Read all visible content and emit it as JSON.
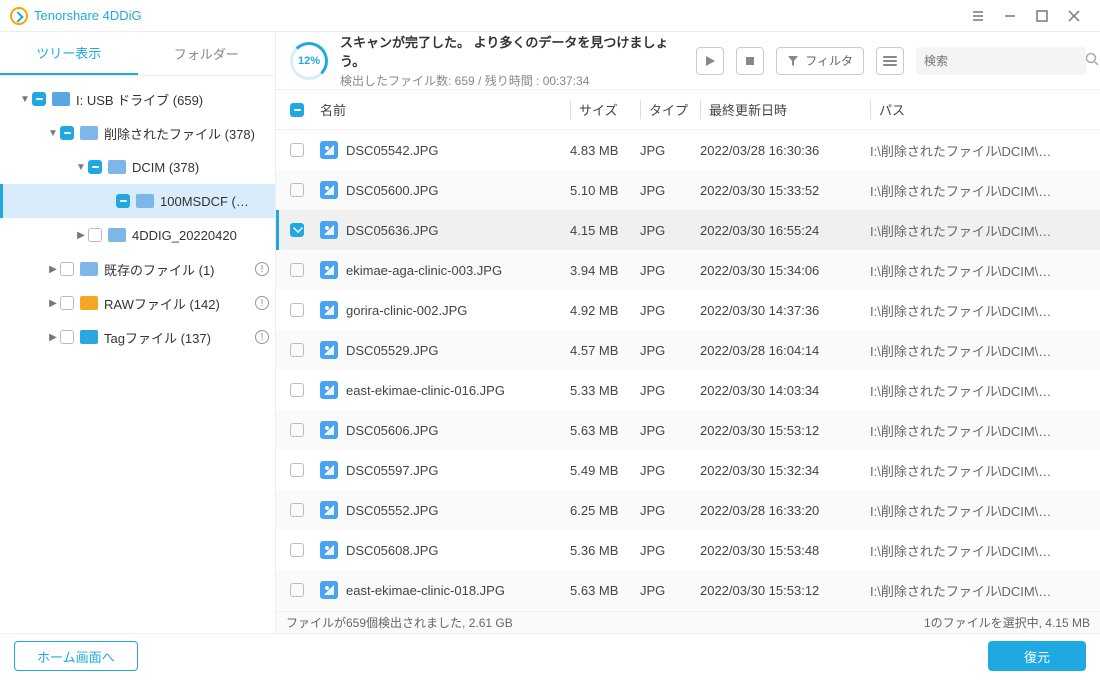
{
  "app_title": "Tenorshare 4DDiG",
  "sidebar": {
    "tab_active": "ツリー表示",
    "tab_inactive": "フォルダー",
    "nodes": [
      {
        "indent": 18,
        "expanded": true,
        "checked": true,
        "icon": "drive",
        "label": "I: USB ドライブ (659)"
      },
      {
        "indent": 46,
        "expanded": true,
        "checked": true,
        "icon": "folder",
        "label": "削除されたファイル (378)"
      },
      {
        "indent": 74,
        "expanded": true,
        "checked": true,
        "icon": "folder",
        "label": "DCIM (378)"
      },
      {
        "indent": 102,
        "expanded": null,
        "checked": true,
        "icon": "folder",
        "label": "100MSDCF (…",
        "selected": true
      },
      {
        "indent": 74,
        "expanded": false,
        "checked": false,
        "icon": "folder",
        "label": "4DDIG_20220420"
      },
      {
        "indent": 46,
        "expanded": false,
        "checked": false,
        "icon": "folder",
        "label": "既存のファイル (1)",
        "alert": true
      },
      {
        "indent": 46,
        "expanded": false,
        "checked": false,
        "icon": "raw",
        "label": "RAWファイル (142)",
        "alert": true
      },
      {
        "indent": 46,
        "expanded": false,
        "checked": false,
        "icon": "tag",
        "label": "Tagファイル (137)",
        "alert": true
      }
    ]
  },
  "toolbar": {
    "progress_pct": "12%",
    "scan_line1": "スキャンが完了した。 より多くのデータを見つけましょう。",
    "scan_line2": "検出したファイル数:  659 /  残り時間 : 00:37:34",
    "filter_label": "フィルタ",
    "search_placeholder": "検索"
  },
  "table": {
    "headers": {
      "name": "名前",
      "size": "サイズ",
      "type": "タイプ",
      "date": "最終更新日時",
      "path": "パス"
    },
    "rows": [
      {
        "checked": false,
        "name": "DSC05542.JPG",
        "size": "4.83 MB",
        "type": "JPG",
        "date": "2022/03/28 16:30:36",
        "path": "I:\\削除されたファイル\\DCIM\\…"
      },
      {
        "checked": false,
        "name": "DSC05600.JPG",
        "size": "5.10 MB",
        "type": "JPG",
        "date": "2022/03/30 15:33:52",
        "path": "I:\\削除されたファイル\\DCIM\\…"
      },
      {
        "checked": true,
        "selected": true,
        "name": "DSC05636.JPG",
        "size": "4.15 MB",
        "type": "JPG",
        "date": "2022/03/30 16:55:24",
        "path": "I:\\削除されたファイル\\DCIM\\…"
      },
      {
        "checked": false,
        "name": "ekimae-aga-clinic-003.JPG",
        "size": "3.94 MB",
        "type": "JPG",
        "date": "2022/03/30 15:34:06",
        "path": "I:\\削除されたファイル\\DCIM\\…"
      },
      {
        "checked": false,
        "name": "gorira-clinic-002.JPG",
        "size": "4.92 MB",
        "type": "JPG",
        "date": "2022/03/30 14:37:36",
        "path": "I:\\削除されたファイル\\DCIM\\…"
      },
      {
        "checked": false,
        "name": "DSC05529.JPG",
        "size": "4.57 MB",
        "type": "JPG",
        "date": "2022/03/28 16:04:14",
        "path": "I:\\削除されたファイル\\DCIM\\…"
      },
      {
        "checked": false,
        "name": "east-ekimae-clinic-016.JPG",
        "size": "5.33 MB",
        "type": "JPG",
        "date": "2022/03/30 14:03:34",
        "path": "I:\\削除されたファイル\\DCIM\\…"
      },
      {
        "checked": false,
        "name": "DSC05606.JPG",
        "size": "5.63 MB",
        "type": "JPG",
        "date": "2022/03/30 15:53:12",
        "path": "I:\\削除されたファイル\\DCIM\\…"
      },
      {
        "checked": false,
        "name": "DSC05597.JPG",
        "size": "5.49 MB",
        "type": "JPG",
        "date": "2022/03/30 15:32:34",
        "path": "I:\\削除されたファイル\\DCIM\\…"
      },
      {
        "checked": false,
        "name": "DSC05552.JPG",
        "size": "6.25 MB",
        "type": "JPG",
        "date": "2022/03/28 16:33:20",
        "path": "I:\\削除されたファイル\\DCIM\\…"
      },
      {
        "checked": false,
        "name": "DSC05608.JPG",
        "size": "5.36 MB",
        "type": "JPG",
        "date": "2022/03/30 15:53:48",
        "path": "I:\\削除されたファイル\\DCIM\\…"
      },
      {
        "checked": false,
        "name": "east-ekimae-clinic-018.JPG",
        "size": "5.63 MB",
        "type": "JPG",
        "date": "2022/03/30 15:53:12",
        "path": "I:\\削除されたファイル\\DCIM\\…"
      }
    ]
  },
  "statusbar": {
    "left": "ファイルが659個検出されました, 2.61 GB",
    "right": "1のファイルを選択中, 4.15 MB"
  },
  "footer": {
    "home_label": "ホーム画面へ",
    "recover_label": "復元"
  }
}
